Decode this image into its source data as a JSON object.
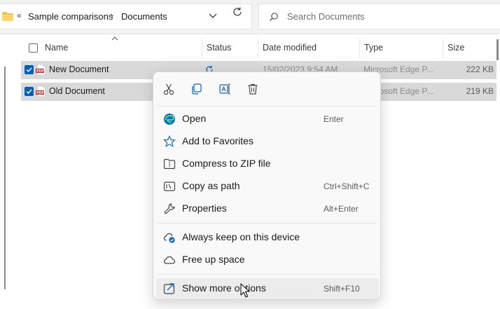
{
  "address_bar": {
    "overflow_chevron": "«",
    "crumbs": [
      "Sample comparisons",
      "Documents"
    ],
    "separator": "›"
  },
  "search": {
    "placeholder": "Search Documents"
  },
  "columns": [
    "Name",
    "Status",
    "Date modified",
    "Type",
    "Size"
  ],
  "files": [
    {
      "name": "New Document",
      "date": "15/02/2023 9:54 AM",
      "type": "Microsoft Edge P...",
      "size": "222 KB",
      "selected": true
    },
    {
      "name": "Old Document",
      "date": "",
      "type": "Microsoft Edge P...",
      "size": "219 KB",
      "selected": true
    }
  ],
  "context_menu": {
    "quick_actions": [
      "cut-icon",
      "copy-icon",
      "rename-icon",
      "delete-icon"
    ],
    "items": [
      {
        "icon": "edge-icon",
        "label": "Open",
        "shortcut": "Enter"
      },
      {
        "icon": "star-icon",
        "label": "Add to Favorites",
        "shortcut": ""
      },
      {
        "icon": "zip-icon",
        "label": "Compress to ZIP file",
        "shortcut": ""
      },
      {
        "icon": "path-icon",
        "label": "Copy as path",
        "shortcut": "Ctrl+Shift+C"
      },
      {
        "icon": "wrench-icon",
        "label": "Properties",
        "shortcut": "Alt+Enter"
      },
      {
        "icon": "cloud-check-icon",
        "label": "Always keep on this device",
        "shortcut": ""
      },
      {
        "icon": "cloud-icon",
        "label": "Free up space",
        "shortcut": ""
      },
      {
        "icon": "share-out-icon",
        "label": "Show more options",
        "shortcut": "Shift+F10"
      }
    ]
  },
  "colors": {
    "accent": "#005fb8",
    "selection": "#d9d9d9",
    "pdf_red": "#c4262e",
    "onedrive_blue": "#0f6cbd"
  }
}
